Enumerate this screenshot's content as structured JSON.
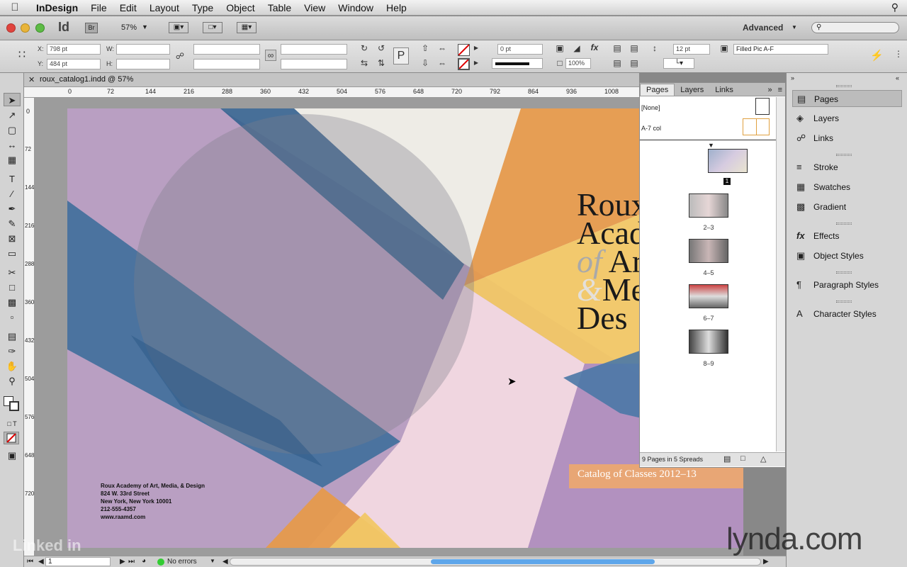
{
  "menubar": {
    "app": "InDesign",
    "items": [
      "File",
      "Edit",
      "Layout",
      "Type",
      "Object",
      "Table",
      "View",
      "Window",
      "Help"
    ]
  },
  "appbar": {
    "logo": "Id",
    "bridge": "Br",
    "zoom": "57%",
    "workspace": "Advanced",
    "search_placeholder": ""
  },
  "control": {
    "x": "798 pt",
    "y": "484 pt",
    "x_label": "X:",
    "y_label": "Y:",
    "w_label": "W:",
    "h_label": "H:",
    "stroke_weight": "0 pt",
    "opacity": "100%",
    "gutter": "12 pt",
    "object_style": "Filled Pic A-F"
  },
  "document": {
    "tab_title": "roux_catalog1.indd @ 57%",
    "ruler_h": [
      "0",
      "72",
      "144",
      "216",
      "288",
      "360",
      "432",
      "504",
      "576",
      "648",
      "720",
      "792",
      "864",
      "936",
      "1008"
    ],
    "ruler_v": [
      "0",
      "72",
      "144",
      "216",
      "288",
      "360",
      "432",
      "504",
      "576",
      "648",
      "720"
    ]
  },
  "cover": {
    "title_lines": [
      "Roux",
      "Acad",
      "of",
      "Art",
      "&",
      "Med",
      "Des"
    ],
    "catalog": "Catalog of Classes 2012–13",
    "address": [
      "Roux Academy of Art, Media, & Design",
      "824 W. 33rd Street",
      "New York, New York 10001",
      "212-555-4357",
      "www.raamd.com"
    ]
  },
  "pages_panel": {
    "tabs": [
      "Pages",
      "Layers",
      "Links"
    ],
    "masters": [
      "[None]",
      "A-7 col"
    ],
    "spreads": [
      "1",
      "2–3",
      "4–5",
      "6–7",
      "8–9"
    ],
    "footer": "9 Pages in 5 Spreads"
  },
  "sidebar": {
    "groups": [
      [
        "Pages",
        "Layers",
        "Links"
      ],
      [
        "Stroke",
        "Swatches",
        "Gradient"
      ],
      [
        "Effects",
        "Object Styles"
      ],
      [
        "Paragraph Styles"
      ],
      [
        "Character Styles"
      ]
    ]
  },
  "status": {
    "page": "1",
    "errors": "No errors"
  },
  "watermarks": {
    "linkedin": "Linked in",
    "lynda": "lynda.com"
  },
  "colors": {
    "purple": "#b197bd",
    "blue": "#3f6e9b",
    "orange": "#e59a4c",
    "yellow": "#f1c766",
    "gray": "#bdbdbd"
  }
}
